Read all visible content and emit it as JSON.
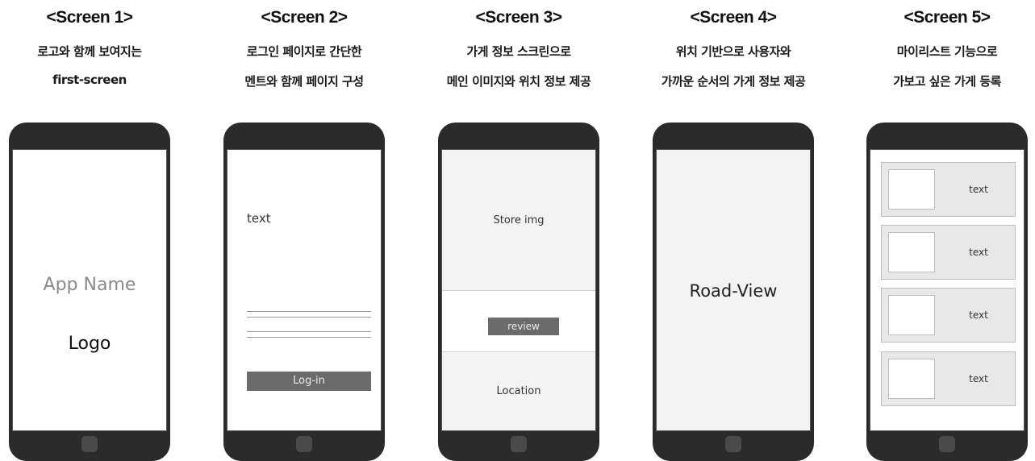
{
  "screens": [
    {
      "title": "<Screen 1>",
      "caption": [
        "로고와 함께 보여지는",
        "first-screen"
      ],
      "app_name": "App Name",
      "logo": "Logo"
    },
    {
      "title": "<Screen 2>",
      "caption": [
        "로그인 페이지로 간단한",
        "멘트와 함께 페이지 구성"
      ],
      "text": "text",
      "login_button": "Log-in"
    },
    {
      "title": "<Screen 3>",
      "caption": [
        "가게 정보 스크린으로",
        "메인 이미지와 위치 정보 제공"
      ],
      "store_img": "Store img",
      "review_button": "review",
      "location": "Location"
    },
    {
      "title": "<Screen 4>",
      "caption": [
        "위치 기반으로 사용자와",
        "가까운 순서의 가게 정보 제공"
      ],
      "road_view": "Road-View"
    },
    {
      "title": "<Screen 5>",
      "caption": [
        "마이리스트 기능으로",
        "가보고 싶은 가게 등록"
      ],
      "items": [
        "text",
        "text",
        "text",
        "text"
      ]
    }
  ]
}
